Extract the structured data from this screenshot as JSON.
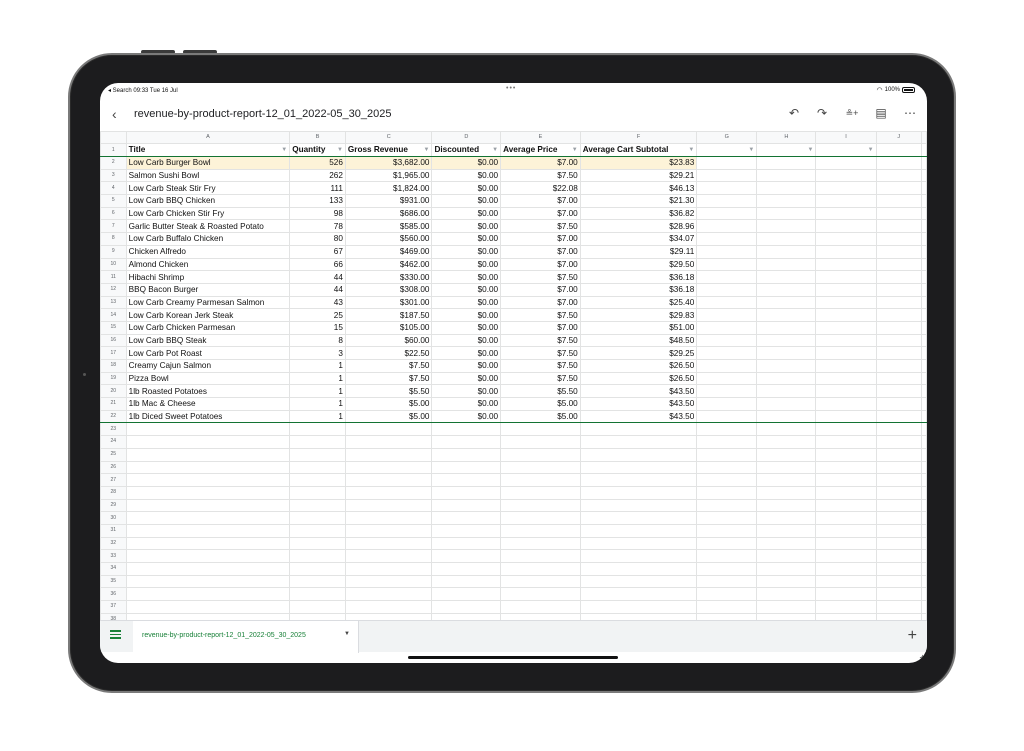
{
  "status": {
    "left": "◂ Search  09:33  Tue 16 Jul",
    "dots": "•••",
    "battery": "100%"
  },
  "toolbar": {
    "back_icon": "‹",
    "title": "revenue-by-product-report-12_01_2022-05_30_2025",
    "undo_icon": "↶",
    "redo_icon": "↷",
    "share_icon": "≗+",
    "comment_icon": "▤",
    "more_icon": "⋯"
  },
  "columns": [
    "A",
    "B",
    "C",
    "D",
    "E",
    "F",
    "G",
    "H",
    "I",
    "J"
  ],
  "headers": [
    "Title",
    "Quantity",
    "Gross Revenue",
    "Discounted",
    "Average Price",
    "Average Cart Subtotal"
  ],
  "rows": [
    [
      "Low Carb Burger Bowl",
      "526",
      "$3,682.00",
      "$0.00",
      "$7.00",
      "$23.83"
    ],
    [
      "Salmon Sushi Bowl",
      "262",
      "$1,965.00",
      "$0.00",
      "$7.50",
      "$29.21"
    ],
    [
      "Low Carb Steak Stir Fry",
      "111",
      "$1,824.00",
      "$0.00",
      "$22.08",
      "$46.13"
    ],
    [
      "Low Carb BBQ Chicken",
      "133",
      "$931.00",
      "$0.00",
      "$7.00",
      "$21.30"
    ],
    [
      "Low Carb Chicken Stir Fry",
      "98",
      "$686.00",
      "$0.00",
      "$7.00",
      "$36.82"
    ],
    [
      "Garlic Butter Steak & Roasted Potato",
      "78",
      "$585.00",
      "$0.00",
      "$7.50",
      "$28.96"
    ],
    [
      "Low Carb Buffalo Chicken",
      "80",
      "$560.00",
      "$0.00",
      "$7.00",
      "$34.07"
    ],
    [
      "Chicken Alfredo",
      "67",
      "$469.00",
      "$0.00",
      "$7.00",
      "$29.11"
    ],
    [
      "Almond Chicken",
      "66",
      "$462.00",
      "$0.00",
      "$7.00",
      "$29.50"
    ],
    [
      "Hibachi Shrimp",
      "44",
      "$330.00",
      "$0.00",
      "$7.50",
      "$36.18"
    ],
    [
      "BBQ Bacon Burger",
      "44",
      "$308.00",
      "$0.00",
      "$7.00",
      "$36.18"
    ],
    [
      "Low Carb Creamy Parmesan Salmon",
      "43",
      "$301.00",
      "$0.00",
      "$7.00",
      "$25.40"
    ],
    [
      "Low Carb Korean Jerk Steak",
      "25",
      "$187.50",
      "$0.00",
      "$7.50",
      "$29.83"
    ],
    [
      "Low Carb Chicken Parmesan",
      "15",
      "$105.00",
      "$0.00",
      "$7.00",
      "$51.00"
    ],
    [
      "Low Carb BBQ Steak",
      "8",
      "$60.00",
      "$0.00",
      "$7.50",
      "$48.50"
    ],
    [
      "Low Carb Pot Roast",
      "3",
      "$22.50",
      "$0.00",
      "$7.50",
      "$29.25"
    ],
    [
      "Creamy Cajun Salmon",
      "1",
      "$7.50",
      "$0.00",
      "$7.50",
      "$26.50"
    ],
    [
      "Pizza Bowl",
      "1",
      "$7.50",
      "$0.00",
      "$7.50",
      "$26.50"
    ],
    [
      "1lb Roasted Potatoes",
      "1",
      "$5.50",
      "$0.00",
      "$5.50",
      "$43.50"
    ],
    [
      "1lb Mac & Cheese",
      "1",
      "$5.00",
      "$0.00",
      "$5.00",
      "$43.50"
    ],
    [
      "1lb Diced Sweet Potatoes",
      "1",
      "$5.00",
      "$0.00",
      "$5.00",
      "$43.50"
    ]
  ],
  "row_numbers": [
    "1",
    "2",
    "3",
    "4",
    "5",
    "6",
    "7",
    "8",
    "9",
    "10",
    "11",
    "12",
    "13",
    "14",
    "15",
    "16",
    "17",
    "18",
    "19",
    "20",
    "21",
    "22",
    "23",
    "24",
    "25",
    "26",
    "27",
    "28",
    "29",
    "30",
    "31",
    "32",
    "33",
    "34",
    "35",
    "36",
    "37",
    "38",
    "39"
  ],
  "filter_icon": "▼",
  "sheet_tab": {
    "label": "revenue-by-product-report-12_01_2022-05_30_2025",
    "caret": "▼"
  },
  "add_sheet_icon": "+",
  "colors": {
    "accent": "#188038",
    "highlight": "#fdf3d8"
  }
}
